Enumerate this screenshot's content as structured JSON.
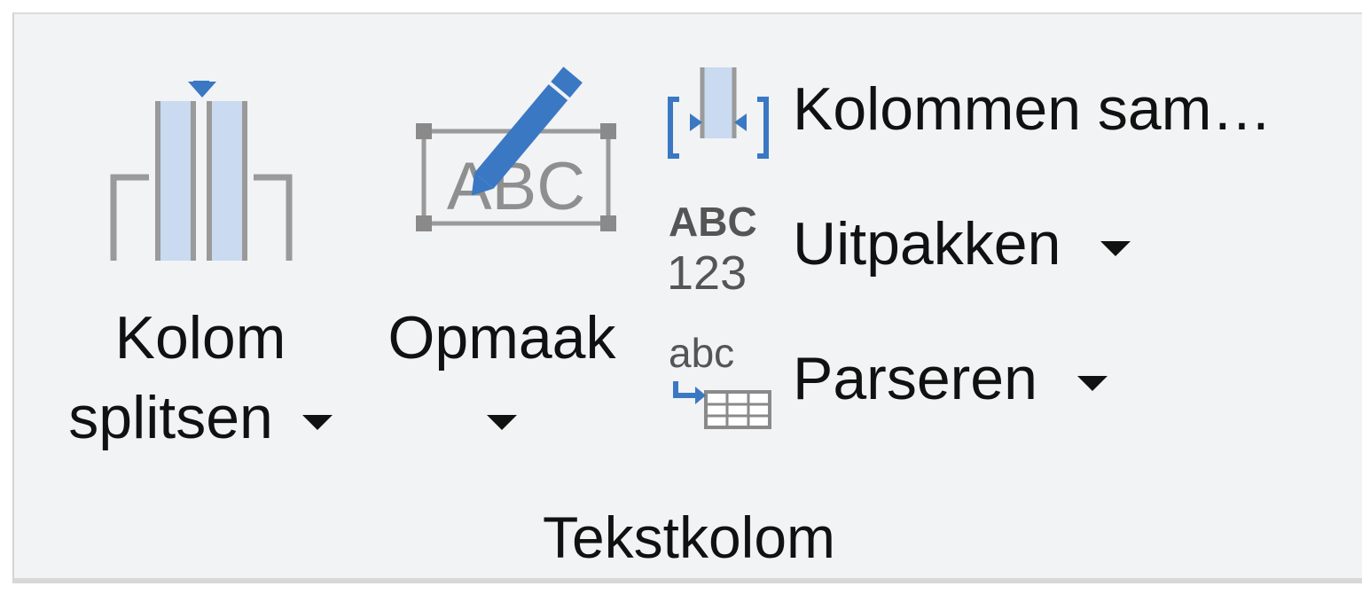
{
  "ribbon": {
    "group_label": "Tekstkolom",
    "buttons": {
      "split_column": {
        "label_line1": "Kolom",
        "label_line2": "splitsen",
        "icon": "split-column-icon"
      },
      "format": {
        "label": "Opmaak",
        "icon": "format-text-icon"
      },
      "merge_columns": {
        "label": "Kolommen sam…",
        "icon": "merge-columns-icon"
      },
      "extract": {
        "label": "Uitpakken",
        "icon": "extract-abc123-icon"
      },
      "parse": {
        "label": "Parseren",
        "icon": "parse-table-icon"
      }
    },
    "colors": {
      "accent_blue": "#3a78c4",
      "light_blue": "#c9daf1",
      "icon_gray": "#8f8f8f",
      "background": "#f2f3f4"
    }
  }
}
